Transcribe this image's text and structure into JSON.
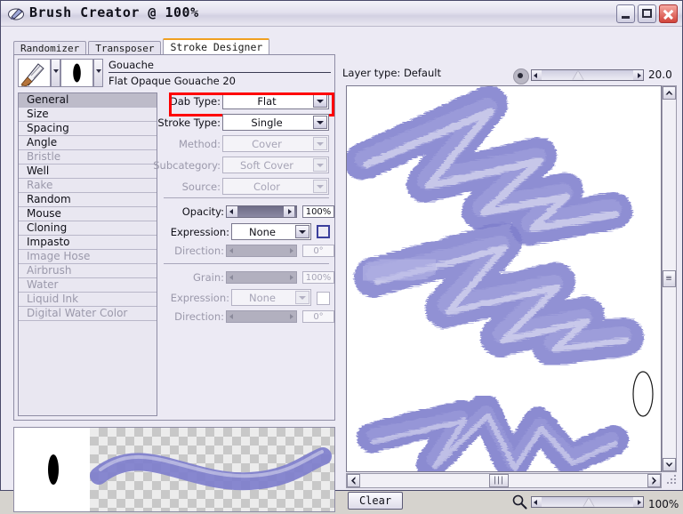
{
  "window": {
    "title": "Brush Creator @ 100%",
    "icon": "brush-app-icon",
    "minimize_label": "minimize-icon",
    "maximize_label": "maximize-icon",
    "close_label": "close-icon"
  },
  "tabs": [
    {
      "label": "Randomizer",
      "active": false
    },
    {
      "label": "Transposer",
      "active": false
    },
    {
      "label": "Stroke Designer",
      "active": true
    }
  ],
  "brush": {
    "category_name": "Gouache",
    "variant_name": "Flat Opaque Gouache 20",
    "brush_icon": "paintbrush-icon",
    "dab_icon": "dab-shape-icon"
  },
  "categories": [
    {
      "label": "General",
      "selected": true,
      "disabled": false
    },
    {
      "label": "Size",
      "selected": false,
      "disabled": false
    },
    {
      "label": "Spacing",
      "selected": false,
      "disabled": false
    },
    {
      "label": "Angle",
      "selected": false,
      "disabled": false
    },
    {
      "label": "Bristle",
      "selected": false,
      "disabled": true
    },
    {
      "label": "Well",
      "selected": false,
      "disabled": false
    },
    {
      "label": "Rake",
      "selected": false,
      "disabled": true
    },
    {
      "label": "Random",
      "selected": false,
      "disabled": false
    },
    {
      "label": "Mouse",
      "selected": false,
      "disabled": false
    },
    {
      "label": "Cloning",
      "selected": false,
      "disabled": false
    },
    {
      "label": "Impasto",
      "selected": false,
      "disabled": false
    },
    {
      "label": "Image Hose",
      "selected": false,
      "disabled": true
    },
    {
      "label": "Airbrush",
      "selected": false,
      "disabled": true
    },
    {
      "label": "Water",
      "selected": false,
      "disabled": true
    },
    {
      "label": "Liquid Ink",
      "selected": false,
      "disabled": true
    },
    {
      "label": "Digital Water Color",
      "selected": false,
      "disabled": true
    }
  ],
  "general_panel": {
    "dab_type": {
      "label": "Dab Type:",
      "value": "Flat",
      "disabled": false,
      "highlighted": true
    },
    "stroke_type": {
      "label": "Stroke Type:",
      "value": "Single",
      "disabled": false
    },
    "method": {
      "label": "Method:",
      "value": "Cover",
      "disabled": true
    },
    "subcategory": {
      "label": "Subcategory:",
      "value": "Soft Cover",
      "disabled": true
    },
    "source": {
      "label": "Source:",
      "value": "Color",
      "disabled": true
    },
    "opacity": {
      "label": "Opacity:",
      "value": "100%",
      "disabled": false,
      "fill_percent": 100
    },
    "opacity_expression": {
      "label": "Expression:",
      "value": "None",
      "disabled": false
    },
    "opacity_direction": {
      "label": "Direction:",
      "value": "0°",
      "disabled": true,
      "fill_percent": 0
    },
    "grain": {
      "label": "Grain:",
      "value": "100%",
      "disabled": true,
      "fill_percent": 0
    },
    "grain_expression": {
      "label": "Expression:",
      "value": "None",
      "disabled": true
    },
    "grain_direction": {
      "label": "Direction:",
      "value": "0°",
      "disabled": true,
      "fill_percent": 0
    }
  },
  "highlight": {
    "color": "#ff0000"
  },
  "canvas": {
    "layer_type_label": "Layer type: Default",
    "size_value": "20.0",
    "size_slider_percent": 40,
    "zoom_value": "100%",
    "zoom_slider_percent": 50,
    "clear_button": "Clear",
    "magnifier_icon": "magnifier-icon",
    "stroke_color": "#7f7fcd",
    "background": "#ffffff",
    "cursor_icon": "ellipse-cursor-icon"
  },
  "scrollbars": {
    "vertical": {
      "up_icon": "chevron-up-icon",
      "down_icon": "chevron-down-icon",
      "thumb_icon": "scroll-thumb"
    },
    "horizontal": {
      "left_icon": "chevron-left-icon",
      "right_icon": "chevron-right-icon",
      "thumb_icon": "scroll-thumb"
    }
  }
}
